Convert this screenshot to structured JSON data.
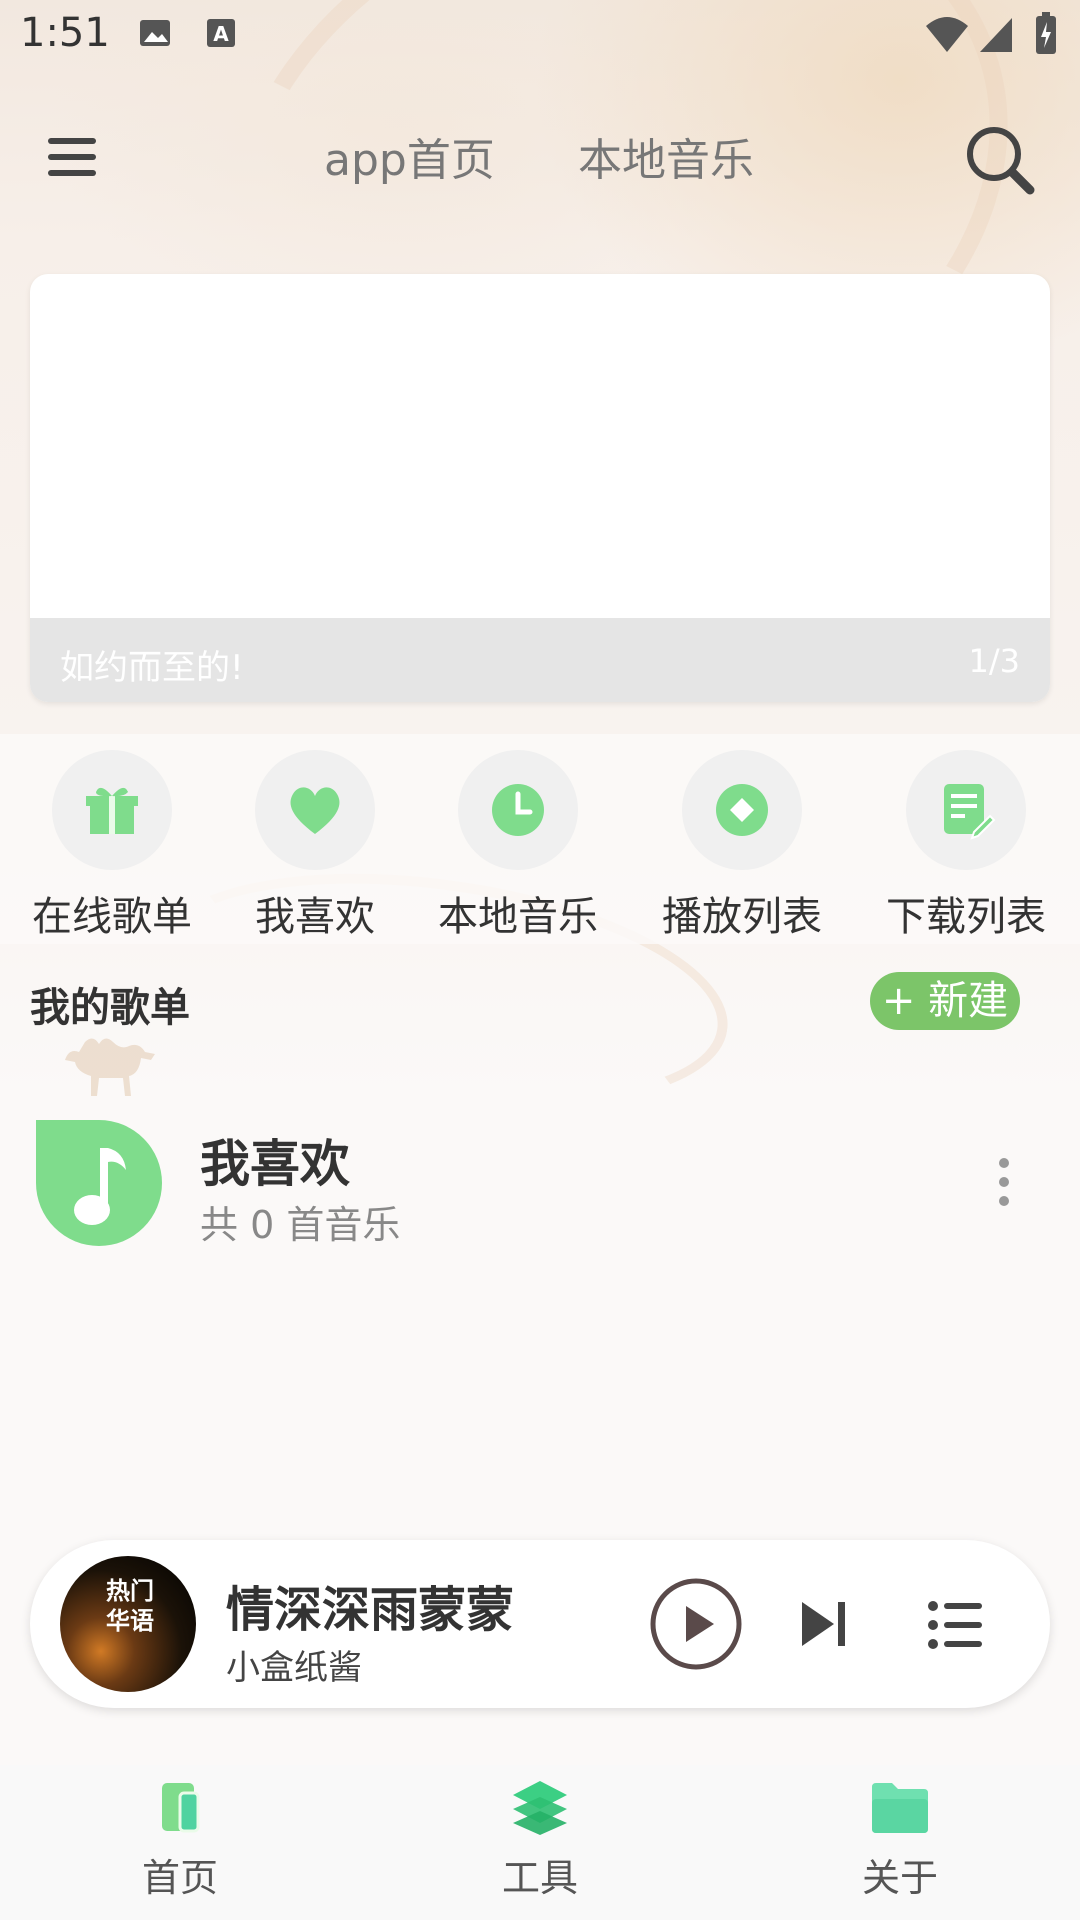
{
  "status_bar": {
    "time": "1:51",
    "icons": [
      "image-icon",
      "font-icon",
      "wifi-icon",
      "signal-icon",
      "battery-icon"
    ]
  },
  "header": {
    "tabs": [
      {
        "label": "app首页"
      },
      {
        "label": "本地音乐"
      }
    ],
    "menu_icon": "menu-icon",
    "search_icon": "search-icon"
  },
  "banner": {
    "caption": "如约而至的!",
    "indicator": "1/3"
  },
  "quick_entries": [
    {
      "label": "在线歌单",
      "icon": "gift-icon"
    },
    {
      "label": "我喜欢",
      "icon": "heart-icon"
    },
    {
      "label": "本地音乐",
      "icon": "clock-icon"
    },
    {
      "label": "播放列表",
      "icon": "diamond-icon"
    },
    {
      "label": "下载列表",
      "icon": "edit-note-icon"
    }
  ],
  "my_playlists": {
    "title": "我的歌单",
    "new_button": "+ 新建",
    "items": [
      {
        "name": "我喜欢",
        "count_text": "共 0 首音乐"
      }
    ]
  },
  "player": {
    "song": "情深深雨蒙蒙",
    "artist": "小盒纸酱",
    "cover_text": "热门\n华语"
  },
  "bottom_nav": [
    {
      "label": "首页",
      "icon": "home-book-icon"
    },
    {
      "label": "工具",
      "icon": "layers-icon"
    },
    {
      "label": "关于",
      "icon": "folder-icon"
    }
  ],
  "colors": {
    "accent_green": "#7cc569",
    "icon_green": "#7fdc8c",
    "nav_teal": "#4fd3a0"
  }
}
